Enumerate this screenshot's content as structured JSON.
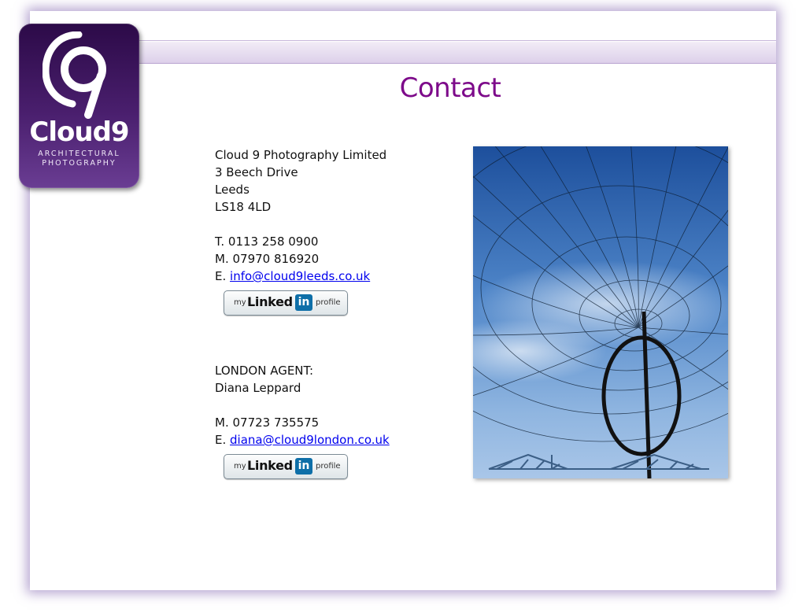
{
  "page": {
    "title": "Contact"
  },
  "logo": {
    "word": "Cloud9",
    "line1": "ARCHITECTURAL",
    "line2": "PHOTOGRAPHY"
  },
  "contact": {
    "company": "Cloud 9 Photography Limited",
    "address1": "3 Beech Drive",
    "address2": "Leeds",
    "postcode": "LS18 4LD",
    "phone": "T. 0113 258 0900",
    "mobile": "M. 07970 816920",
    "email_prefix": "E.",
    "email": "info@cloud9leeds.co.uk"
  },
  "london": {
    "heading": "LONDON AGENT:",
    "name": "Diana Leppard",
    "mobile": "M. 07723 735575",
    "email_prefix": "E.",
    "email": "diana@cloud9london.co.uk"
  },
  "linkedin_badge": {
    "my": "my",
    "linked": "Linked",
    "in": "in",
    "profile": "profile"
  },
  "colors": {
    "title": "#7d0a8a",
    "logo_bg": "#4a1f6e",
    "nav_band": "#ddd0ea",
    "link": "#0000ee"
  }
}
